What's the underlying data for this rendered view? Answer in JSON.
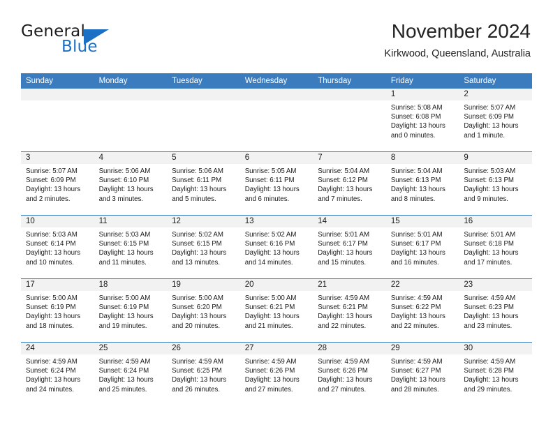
{
  "brand": {
    "name_top": "General",
    "name_bottom": "Blue",
    "accent_color": "#1b6fc4"
  },
  "header": {
    "title": "November 2024",
    "subtitle": "Kirkwood, Queensland, Australia"
  },
  "theme": {
    "header_band": "#3b7cbf",
    "daynum_band": "#f2f2f2",
    "text": "#1a1a1a"
  },
  "weekdays": [
    "Sunday",
    "Monday",
    "Tuesday",
    "Wednesday",
    "Thursday",
    "Friday",
    "Saturday"
  ],
  "labels": {
    "sunrise": "Sunrise:",
    "sunset": "Sunset:",
    "daylight": "Daylight:"
  },
  "weeks": [
    [
      {
        "day": ""
      },
      {
        "day": ""
      },
      {
        "day": ""
      },
      {
        "day": ""
      },
      {
        "day": ""
      },
      {
        "day": "1",
        "sunrise": "Sunrise: 5:08 AM",
        "sunset": "Sunset: 6:08 PM",
        "daylight_1": "Daylight: 13 hours",
        "daylight_2": "and 0 minutes."
      },
      {
        "day": "2",
        "sunrise": "Sunrise: 5:07 AM",
        "sunset": "Sunset: 6:09 PM",
        "daylight_1": "Daylight: 13 hours",
        "daylight_2": "and 1 minute."
      }
    ],
    [
      {
        "day": "3",
        "sunrise": "Sunrise: 5:07 AM",
        "sunset": "Sunset: 6:09 PM",
        "daylight_1": "Daylight: 13 hours",
        "daylight_2": "and 2 minutes."
      },
      {
        "day": "4",
        "sunrise": "Sunrise: 5:06 AM",
        "sunset": "Sunset: 6:10 PM",
        "daylight_1": "Daylight: 13 hours",
        "daylight_2": "and 3 minutes."
      },
      {
        "day": "5",
        "sunrise": "Sunrise: 5:06 AM",
        "sunset": "Sunset: 6:11 PM",
        "daylight_1": "Daylight: 13 hours",
        "daylight_2": "and 5 minutes."
      },
      {
        "day": "6",
        "sunrise": "Sunrise: 5:05 AM",
        "sunset": "Sunset: 6:11 PM",
        "daylight_1": "Daylight: 13 hours",
        "daylight_2": "and 6 minutes."
      },
      {
        "day": "7",
        "sunrise": "Sunrise: 5:04 AM",
        "sunset": "Sunset: 6:12 PM",
        "daylight_1": "Daylight: 13 hours",
        "daylight_2": "and 7 minutes."
      },
      {
        "day": "8",
        "sunrise": "Sunrise: 5:04 AM",
        "sunset": "Sunset: 6:13 PM",
        "daylight_1": "Daylight: 13 hours",
        "daylight_2": "and 8 minutes."
      },
      {
        "day": "9",
        "sunrise": "Sunrise: 5:03 AM",
        "sunset": "Sunset: 6:13 PM",
        "daylight_1": "Daylight: 13 hours",
        "daylight_2": "and 9 minutes."
      }
    ],
    [
      {
        "day": "10",
        "sunrise": "Sunrise: 5:03 AM",
        "sunset": "Sunset: 6:14 PM",
        "daylight_1": "Daylight: 13 hours",
        "daylight_2": "and 10 minutes."
      },
      {
        "day": "11",
        "sunrise": "Sunrise: 5:03 AM",
        "sunset": "Sunset: 6:15 PM",
        "daylight_1": "Daylight: 13 hours",
        "daylight_2": "and 11 minutes."
      },
      {
        "day": "12",
        "sunrise": "Sunrise: 5:02 AM",
        "sunset": "Sunset: 6:15 PM",
        "daylight_1": "Daylight: 13 hours",
        "daylight_2": "and 13 minutes."
      },
      {
        "day": "13",
        "sunrise": "Sunrise: 5:02 AM",
        "sunset": "Sunset: 6:16 PM",
        "daylight_1": "Daylight: 13 hours",
        "daylight_2": "and 14 minutes."
      },
      {
        "day": "14",
        "sunrise": "Sunrise: 5:01 AM",
        "sunset": "Sunset: 6:17 PM",
        "daylight_1": "Daylight: 13 hours",
        "daylight_2": "and 15 minutes."
      },
      {
        "day": "15",
        "sunrise": "Sunrise: 5:01 AM",
        "sunset": "Sunset: 6:17 PM",
        "daylight_1": "Daylight: 13 hours",
        "daylight_2": "and 16 minutes."
      },
      {
        "day": "16",
        "sunrise": "Sunrise: 5:01 AM",
        "sunset": "Sunset: 6:18 PM",
        "daylight_1": "Daylight: 13 hours",
        "daylight_2": "and 17 minutes."
      }
    ],
    [
      {
        "day": "17",
        "sunrise": "Sunrise: 5:00 AM",
        "sunset": "Sunset: 6:19 PM",
        "daylight_1": "Daylight: 13 hours",
        "daylight_2": "and 18 minutes."
      },
      {
        "day": "18",
        "sunrise": "Sunrise: 5:00 AM",
        "sunset": "Sunset: 6:19 PM",
        "daylight_1": "Daylight: 13 hours",
        "daylight_2": "and 19 minutes."
      },
      {
        "day": "19",
        "sunrise": "Sunrise: 5:00 AM",
        "sunset": "Sunset: 6:20 PM",
        "daylight_1": "Daylight: 13 hours",
        "daylight_2": "and 20 minutes."
      },
      {
        "day": "20",
        "sunrise": "Sunrise: 5:00 AM",
        "sunset": "Sunset: 6:21 PM",
        "daylight_1": "Daylight: 13 hours",
        "daylight_2": "and 21 minutes."
      },
      {
        "day": "21",
        "sunrise": "Sunrise: 4:59 AM",
        "sunset": "Sunset: 6:21 PM",
        "daylight_1": "Daylight: 13 hours",
        "daylight_2": "and 22 minutes."
      },
      {
        "day": "22",
        "sunrise": "Sunrise: 4:59 AM",
        "sunset": "Sunset: 6:22 PM",
        "daylight_1": "Daylight: 13 hours",
        "daylight_2": "and 22 minutes."
      },
      {
        "day": "23",
        "sunrise": "Sunrise: 4:59 AM",
        "sunset": "Sunset: 6:23 PM",
        "daylight_1": "Daylight: 13 hours",
        "daylight_2": "and 23 minutes."
      }
    ],
    [
      {
        "day": "24",
        "sunrise": "Sunrise: 4:59 AM",
        "sunset": "Sunset: 6:24 PM",
        "daylight_1": "Daylight: 13 hours",
        "daylight_2": "and 24 minutes."
      },
      {
        "day": "25",
        "sunrise": "Sunrise: 4:59 AM",
        "sunset": "Sunset: 6:24 PM",
        "daylight_1": "Daylight: 13 hours",
        "daylight_2": "and 25 minutes."
      },
      {
        "day": "26",
        "sunrise": "Sunrise: 4:59 AM",
        "sunset": "Sunset: 6:25 PM",
        "daylight_1": "Daylight: 13 hours",
        "daylight_2": "and 26 minutes."
      },
      {
        "day": "27",
        "sunrise": "Sunrise: 4:59 AM",
        "sunset": "Sunset: 6:26 PM",
        "daylight_1": "Daylight: 13 hours",
        "daylight_2": "and 27 minutes."
      },
      {
        "day": "28",
        "sunrise": "Sunrise: 4:59 AM",
        "sunset": "Sunset: 6:26 PM",
        "daylight_1": "Daylight: 13 hours",
        "daylight_2": "and 27 minutes."
      },
      {
        "day": "29",
        "sunrise": "Sunrise: 4:59 AM",
        "sunset": "Sunset: 6:27 PM",
        "daylight_1": "Daylight: 13 hours",
        "daylight_2": "and 28 minutes."
      },
      {
        "day": "30",
        "sunrise": "Sunrise: 4:59 AM",
        "sunset": "Sunset: 6:28 PM",
        "daylight_1": "Daylight: 13 hours",
        "daylight_2": "and 29 minutes."
      }
    ]
  ]
}
